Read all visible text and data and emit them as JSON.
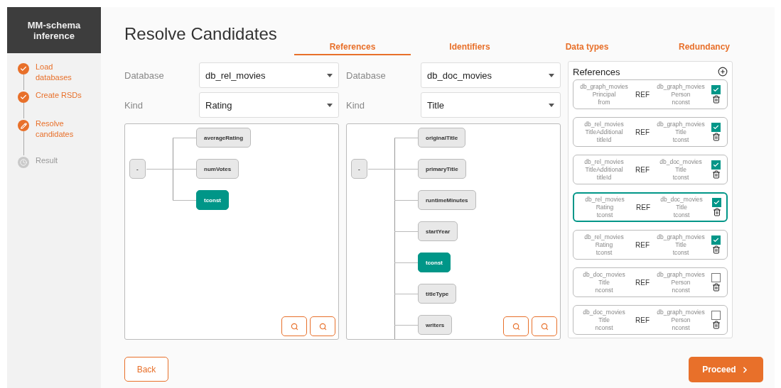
{
  "app_title": "MM-schema inference",
  "steps": [
    {
      "label": "Load databases",
      "completed": true,
      "active": false
    },
    {
      "label": "Create RSDs",
      "completed": true,
      "active": false
    },
    {
      "label": "Resolve candidates",
      "completed": false,
      "active": true
    },
    {
      "label": "Result",
      "completed": false,
      "active": false
    }
  ],
  "page_title": "Resolve Candidates",
  "tabs": [
    {
      "label": "References",
      "selected": true
    },
    {
      "label": "Identifiers",
      "selected": false
    },
    {
      "label": "Data types",
      "selected": false
    },
    {
      "label": "Redundancy",
      "selected": false
    }
  ],
  "sources": [
    {
      "database_label": "Database",
      "database": "db_rel_movies",
      "kind_label": "Kind",
      "kind": "Rating",
      "tree": {
        "root": "-",
        "children": [
          {
            "label": "averageRating",
            "selected": false
          },
          {
            "label": "numVotes",
            "selected": false
          },
          {
            "label": "tconst",
            "selected": true
          }
        ]
      }
    },
    {
      "database_label": "Database",
      "database": "db_doc_movies",
      "kind_label": "Kind",
      "kind": "Title",
      "tree": {
        "root": "-",
        "children": [
          {
            "label": "originalTitle",
            "selected": false
          },
          {
            "label": "primaryTitle",
            "selected": false
          },
          {
            "label": "runtimeMinutes",
            "selected": false
          },
          {
            "label": "startYear",
            "selected": false
          },
          {
            "label": "tconst",
            "selected": true
          },
          {
            "label": "titleType",
            "selected": false
          },
          {
            "label": "writers",
            "selected": false
          }
        ]
      }
    }
  ],
  "references": {
    "title": "References",
    "items": [
      {
        "source": {
          "database": "db_graph_movies",
          "kind": "Principal",
          "field": "from"
        },
        "relation": "REF",
        "target": {
          "database": "db_graph_movies",
          "kind": "Person",
          "field": "nconst"
        },
        "checked": true,
        "selected": false
      },
      {
        "source": {
          "database": "db_rel_movies",
          "kind": "TitleAdditional",
          "field": "titleId"
        },
        "relation": "REF",
        "target": {
          "database": "db_graph_movies",
          "kind": "Title",
          "field": "tconst"
        },
        "checked": true,
        "selected": false
      },
      {
        "source": {
          "database": "db_rel_movies",
          "kind": "TitleAdditional",
          "field": "titleId"
        },
        "relation": "REF",
        "target": {
          "database": "db_doc_movies",
          "kind": "Title",
          "field": "tconst"
        },
        "checked": true,
        "selected": false
      },
      {
        "source": {
          "database": "db_rel_movies",
          "kind": "Rating",
          "field": "tconst"
        },
        "relation": "REF",
        "target": {
          "database": "db_doc_movies",
          "kind": "Title",
          "field": "tconst"
        },
        "checked": true,
        "selected": true
      },
      {
        "source": {
          "database": "db_rel_movies",
          "kind": "Rating",
          "field": "tconst"
        },
        "relation": "REF",
        "target": {
          "database": "db_graph_movies",
          "kind": "Title",
          "field": "tconst"
        },
        "checked": true,
        "selected": false
      },
      {
        "source": {
          "database": "db_doc_movies",
          "kind": "Title",
          "field": "nconst"
        },
        "relation": "REF",
        "target": {
          "database": "db_graph_movies",
          "kind": "Person",
          "field": "nconst"
        },
        "checked": false,
        "selected": false
      },
      {
        "source": {
          "database": "db_doc_movies",
          "kind": "Title",
          "field": "nconst"
        },
        "relation": "REF",
        "target": {
          "database": "db_graph_movies",
          "kind": "Person",
          "field": "nconst"
        },
        "checked": false,
        "selected": false
      }
    ]
  },
  "buttons": {
    "back": "Back",
    "proceed": "Proceed"
  }
}
